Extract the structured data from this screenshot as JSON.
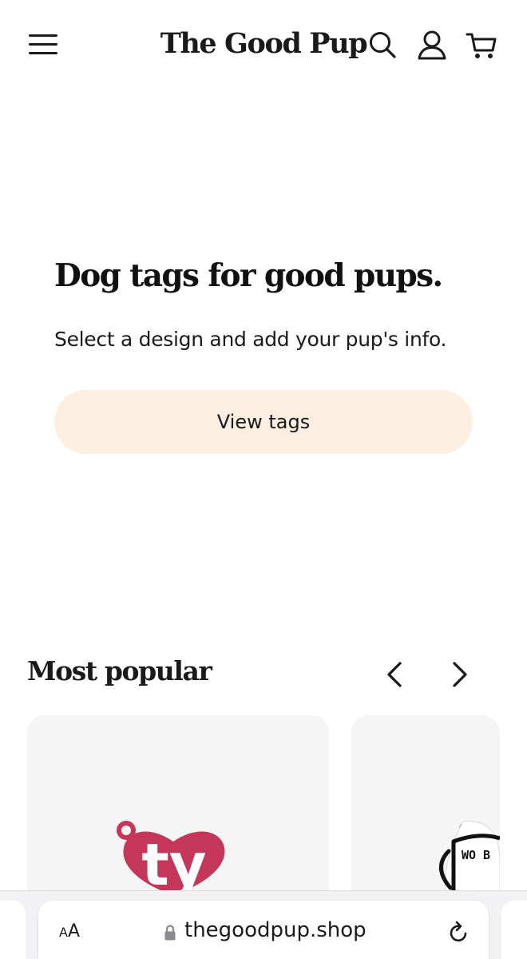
{
  "header": {
    "brand": "The Good Pup",
    "menu_icon": "hamburger-menu-icon",
    "search_icon": "search-icon",
    "account_icon": "user-account-icon",
    "cart_icon": "shopping-cart-icon"
  },
  "hero": {
    "title": "Dog tags for good pups.",
    "subtitle": "Select a design and add your pup's info.",
    "cta_label": "View tags",
    "cta_color": "#fcefe1"
  },
  "popular": {
    "title": "Most popular",
    "prev_icon": "chevron-left-icon",
    "next_icon": "chevron-right-icon",
    "products": [
      {
        "image": "heart-tag-image",
        "tag_text": "ty",
        "tag_color": "#c4375a"
      },
      {
        "image": "mug-tag-image",
        "tag_text": "WO B"
      }
    ]
  },
  "browser": {
    "text_size_small": "A",
    "text_size_large": "A",
    "url": "thegoodpup.shop",
    "lock_icon": "lock-icon",
    "reload_icon": "reload-icon"
  }
}
